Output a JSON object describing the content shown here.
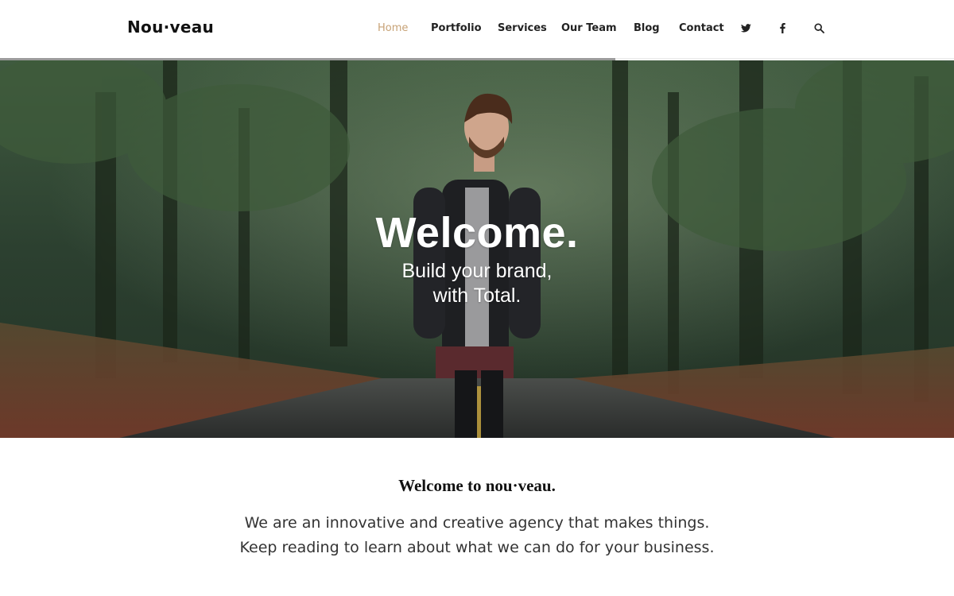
{
  "brand": {
    "logo_text": "Nou·veau"
  },
  "nav": {
    "items": [
      {
        "label": "Home",
        "active": true
      },
      {
        "label": "Portfolio",
        "active": false
      },
      {
        "label": "Services",
        "active": false
      },
      {
        "label": "Our Team",
        "active": false
      },
      {
        "label": "Blog",
        "active": false
      },
      {
        "label": "Contact",
        "active": false
      }
    ],
    "icons": [
      "twitter-icon",
      "facebook-icon",
      "search-icon"
    ],
    "accent_color": "#c7a276"
  },
  "scroll_progress": {
    "fraction": 0.645
  },
  "hero": {
    "title": "Welcome.",
    "subtitle_line1": "Build your brand,",
    "subtitle_line2": "with Total."
  },
  "intro": {
    "heading": "Welcome to nou·veau.",
    "body": "We are an innovative and creative agency that makes things. Keep reading to learn about what we can do for your business."
  }
}
